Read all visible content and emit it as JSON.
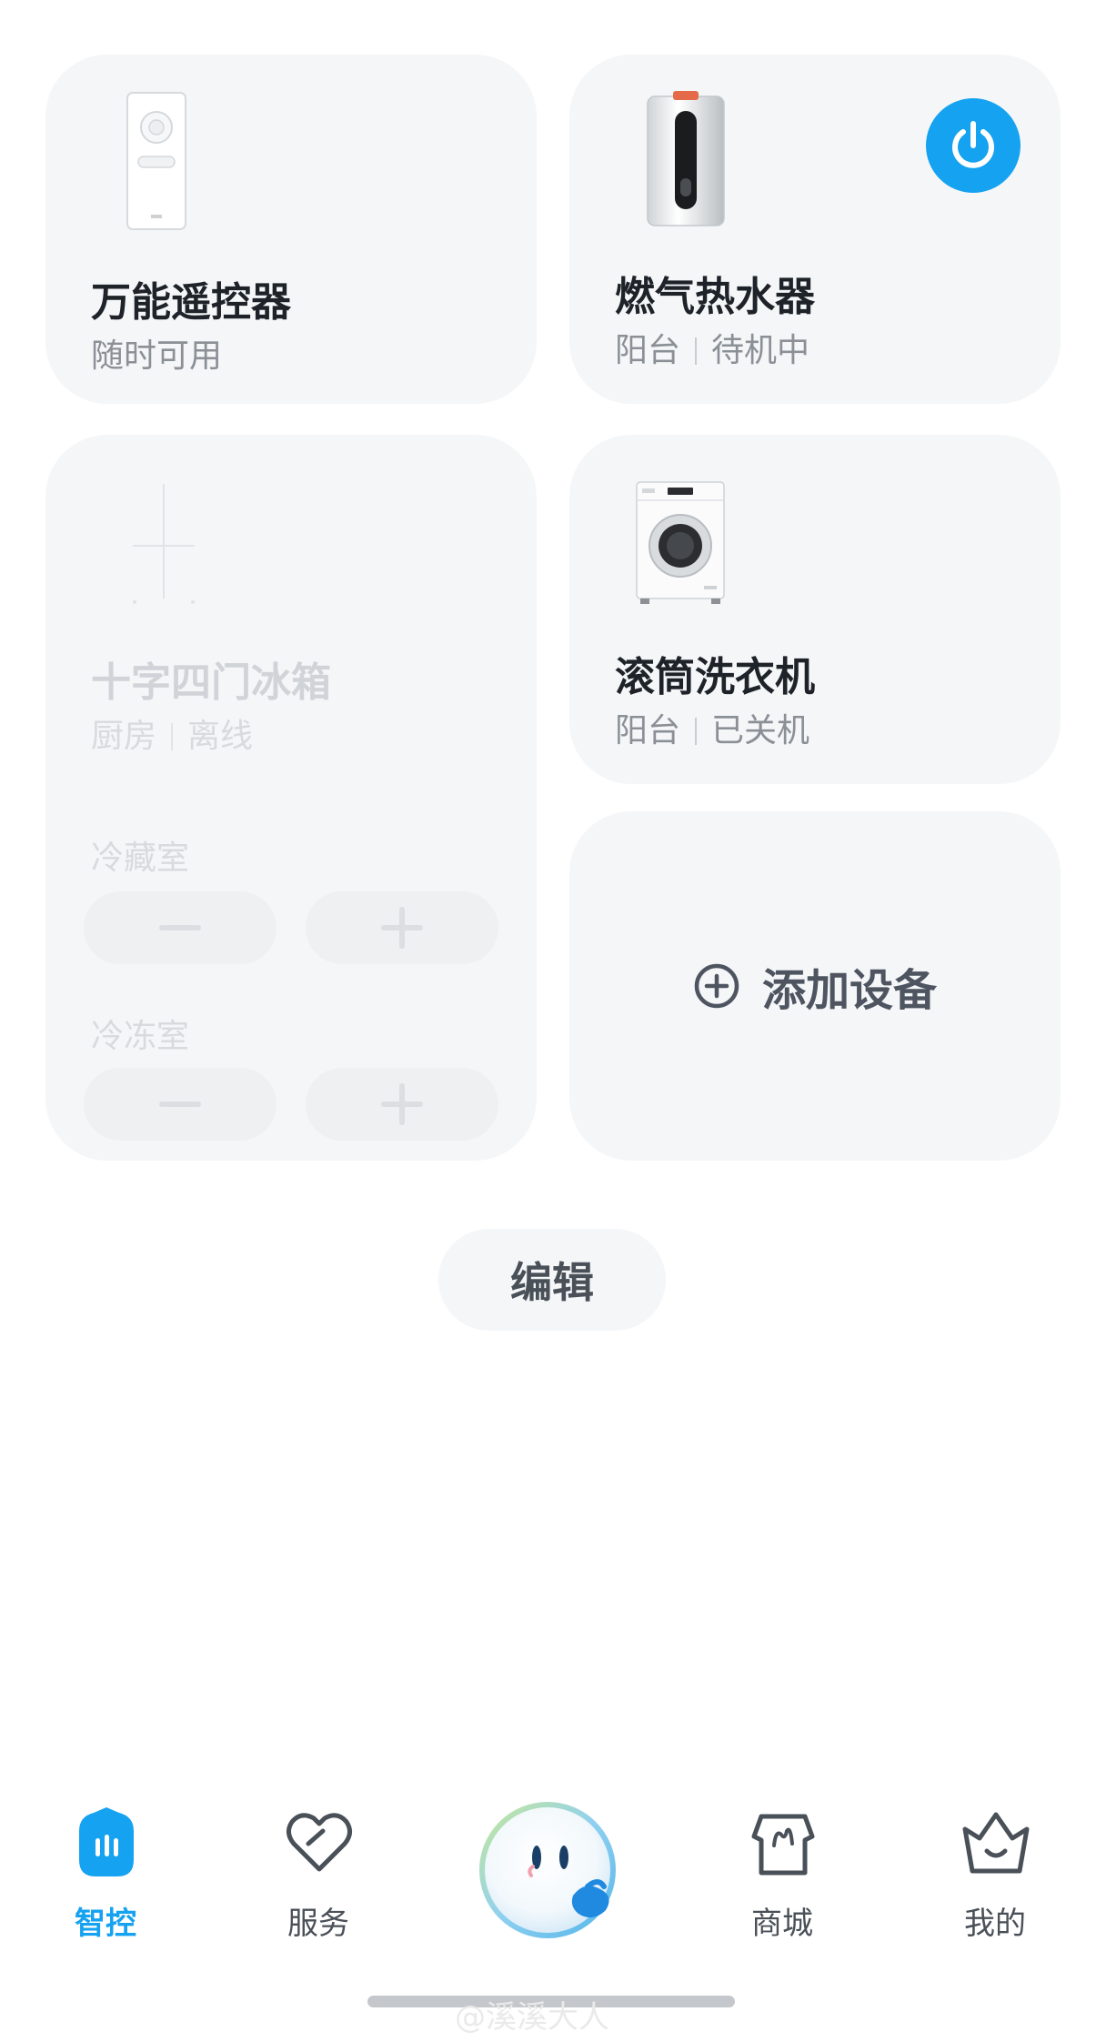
{
  "devices": [
    {
      "name": "万能遥控器",
      "status": "随时可用"
    },
    {
      "name": "燃气热水器",
      "room": "阳台",
      "status": "待机中",
      "power_state": "on"
    },
    {
      "name": "十字四门冰箱",
      "room": "厨房",
      "status": "离线",
      "zones": [
        {
          "label": "冷藏室"
        },
        {
          "label": "冷冻室"
        }
      ]
    },
    {
      "name": "滚筒洗衣机",
      "room": "阳台",
      "status": "已关机"
    }
  ],
  "add_device": {
    "label": "添加设备",
    "icon": "add-circle-icon"
  },
  "edit_button": {
    "label": "编辑"
  },
  "bottom_nav": {
    "items": [
      {
        "label": "智控",
        "icon": "smart-control-icon",
        "active": true
      },
      {
        "label": "服务",
        "icon": "heart-icon",
        "active": false
      },
      {
        "label": "",
        "icon": "assistant-mascot-icon",
        "active": false
      },
      {
        "label": "商城",
        "icon": "shop-icon",
        "active": false
      },
      {
        "label": "我的",
        "icon": "profile-basket-icon",
        "active": false
      }
    ]
  },
  "watermark": "@溪溪大人",
  "colors": {
    "accent": "#15a2f0",
    "card_bg": "#f4f6f8",
    "text_primary": "#1e2329",
    "text_secondary": "#8b9096"
  }
}
